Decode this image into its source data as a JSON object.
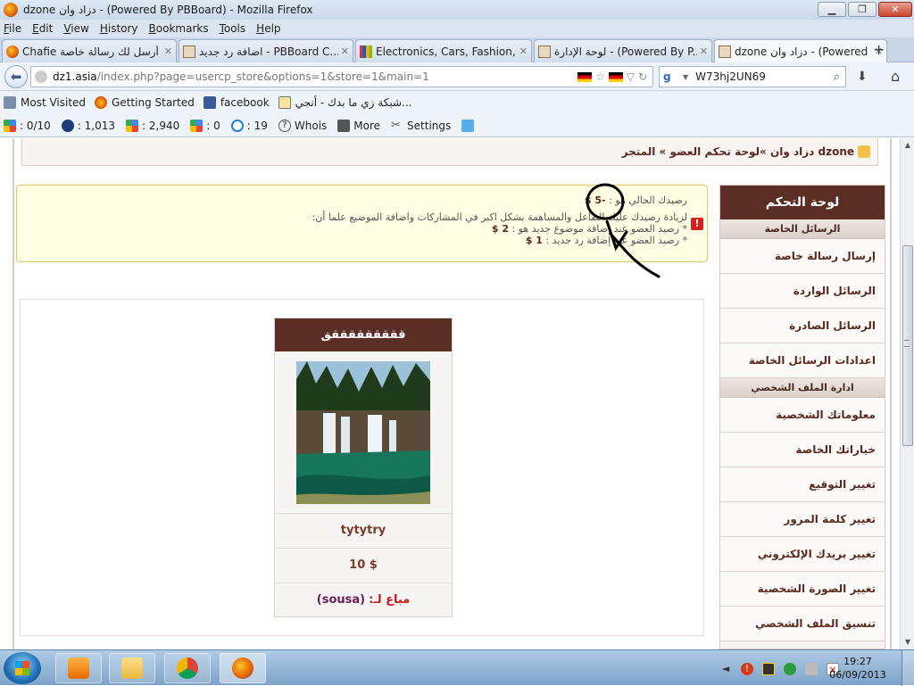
{
  "window": {
    "title": "dzone دزاد وان - (Powered By PBBoard) - Mozilla Firefox"
  },
  "menu": [
    "File",
    "Edit",
    "View",
    "History",
    "Bookmarks",
    "Tools",
    "Help"
  ],
  "tabs": [
    {
      "label": "Chafie أرسل لك رسالة خاصة"
    },
    {
      "label": "اضافة رد جديد - PBBoard C..."
    },
    {
      "label": "Electronics, Cars, Fashion, C..."
    },
    {
      "label": "لوحة الإدارة - (Powered By P..."
    },
    {
      "label": "dzone دزاد وان - (Powered B..."
    }
  ],
  "address": {
    "host": "dz1.asia",
    "path": "/index.php?page=usercp_store&options=1&store=1&main=1"
  },
  "search": {
    "engine": "g",
    "query": "W73hj2UN69"
  },
  "bookmarks": [
    "Most Visited",
    "Getting Started",
    "facebook",
    "شبكة زي ما بدك - أنجي..."
  ],
  "toolbar": {
    "t1": ": 0/10",
    "t2": ": 1,013",
    "t3": ": 2,940",
    "t4": ": 0",
    "t5": ": 19",
    "whois": "Whois",
    "more": "More",
    "settings": "Settings"
  },
  "breadcrumb": "dzone دزاد وان »لوحة تحكم العضو » المتجر",
  "notice": {
    "balance_label": "رصيدك الحالي هو :",
    "balance_value": "-5 $",
    "info": "لزيادة رصيدك عليك التفاعل والمساهمة بشكل اكبر في المشاركات واضافة الموضيع علما أن:",
    "line1_label": "* رصيد العضو عند إضافة موضوع جديد هو :",
    "line1_value": "2 $",
    "line2_label": "* رصيد العضو عند إضافة رد جديد :",
    "line2_value": "1 $"
  },
  "sidebar": {
    "title": "لوحة التحكم",
    "section1": "الرسائل الخاصة",
    "s1_items": [
      "إرسال رسالة خاصة",
      "الرسائل الواردة",
      "الرسائل الصادرة",
      "اعدادات الرسائل الخاصة"
    ],
    "section2": "ادارة الملف الشخصي",
    "s2_items": [
      "معلوماتك الشخصية",
      "خياراتك الخاصة",
      "تغيير التوقيع",
      "تغيير كلمة المرور",
      "تغيير بريدك الإلكتروني",
      "تغيير الصورة الشخصية",
      "تنسيق الملف الشخصي"
    ]
  },
  "product": {
    "title": "قققققققققق",
    "name": "tytytry",
    "price": "10 $",
    "sold_label": "مباع لـ:",
    "sold_to": "(sousa)"
  },
  "clock": {
    "time": "19:27",
    "date": "06/09/2013"
  }
}
